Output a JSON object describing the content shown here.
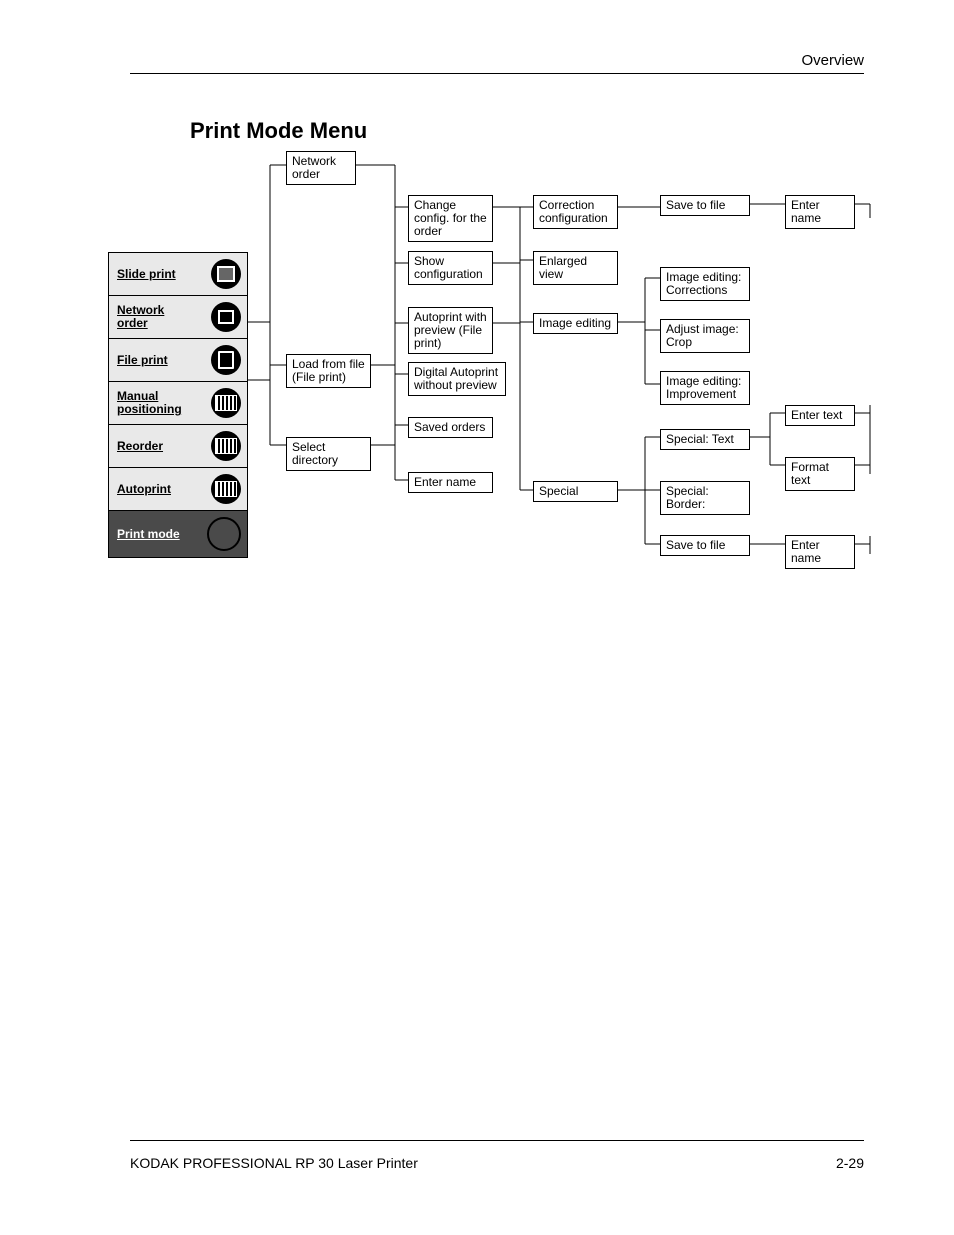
{
  "header": {
    "right": "Overview"
  },
  "title": "Print Mode Menu",
  "footer": {
    "left": "KODAK PROFESSIONAL RP 30 Laser Printer",
    "right": "2-29"
  },
  "sidebar": [
    {
      "label": "Slide print"
    },
    {
      "label": "Network order"
    },
    {
      "label": "File print"
    },
    {
      "label": "Manual positioning"
    },
    {
      "label": "Reorder"
    },
    {
      "label": "Autoprint"
    },
    {
      "label": "Print mode"
    }
  ],
  "col1": {
    "network": "Network order",
    "load": "Load from file (File print)",
    "select": "Select directory"
  },
  "col2": {
    "change": "Change config. for the order",
    "show": "Show configuration",
    "auto": "Autoprint with preview (File print)",
    "digital": "Digital Autoprint without preview",
    "saved": "Saved orders",
    "name": "Enter name"
  },
  "col3": {
    "corr": "Correction configuration",
    "enlarged": "Enlarged view",
    "imgedit": "Image editing",
    "special": "Special"
  },
  "col4": {
    "save": "Save to file",
    "corrections": "Image editing: Corrections",
    "crop": "Adjust image: Crop",
    "improve": "Image editing: Improvement",
    "text": "Special: Text",
    "border": "Special: Border:",
    "save2": "Save to file"
  },
  "col5": {
    "name1": "Enter name",
    "etext": "Enter text",
    "ftext": "Format text",
    "name2": "Enter name"
  }
}
